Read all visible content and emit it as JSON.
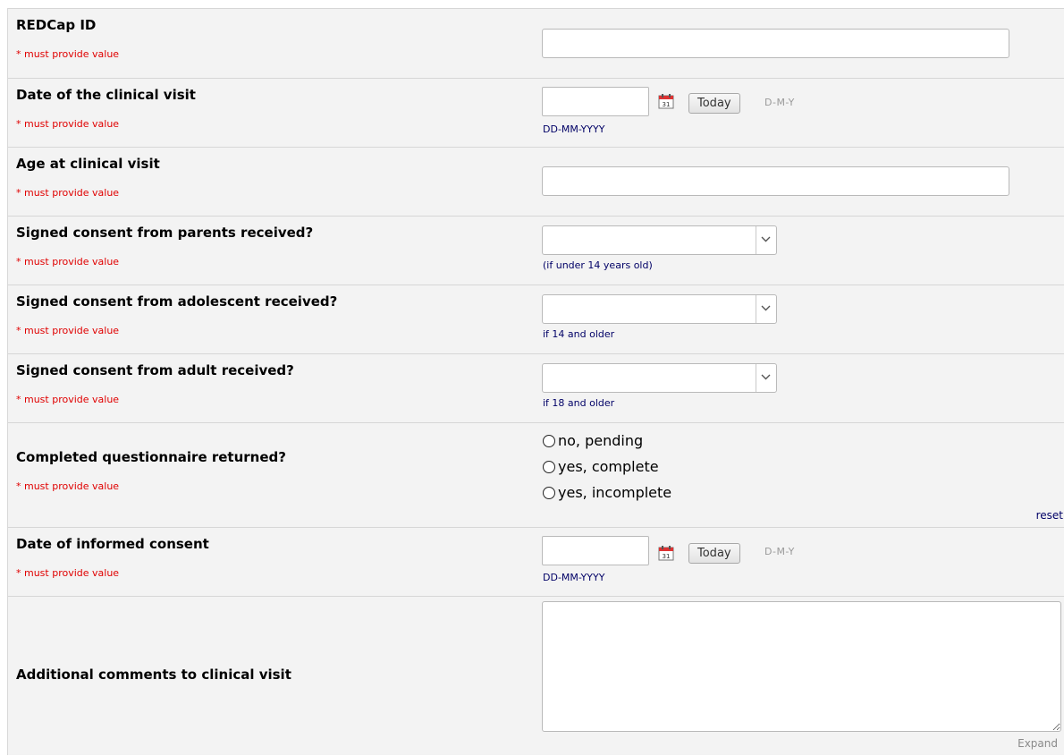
{
  "required_text": "* must provide value",
  "fields": {
    "redcap_id": {
      "label": "REDCap ID",
      "value": ""
    },
    "visit_date": {
      "label": "Date of the clinical visit",
      "value": "",
      "today_label": "Today",
      "format_hint": "D-M-Y",
      "format_note": "DD-MM-YYYY"
    },
    "age": {
      "label": "Age at clinical visit",
      "value": ""
    },
    "consent_parents": {
      "label": "Signed consent from parents received?",
      "selected": "",
      "note": "(if under 14 years old)"
    },
    "consent_adolescent": {
      "label": "Signed consent from adolescent received?",
      "selected": "",
      "note": "if 14 and older"
    },
    "consent_adult": {
      "label": "Signed consent from adult received?",
      "selected": "",
      "note": "if 18 and older"
    },
    "questionnaire": {
      "label": "Completed questionnaire returned?",
      "options": [
        "no, pending",
        "yes, complete",
        "yes, incomplete"
      ],
      "reset_label": "reset"
    },
    "consent_date": {
      "label": "Date of informed consent",
      "value": "",
      "today_label": "Today",
      "format_hint": "D-M-Y",
      "format_note": "DD-MM-YYYY"
    },
    "comments": {
      "label": "Additional comments to clinical visit",
      "value": "",
      "expand_label": "Expand"
    }
  },
  "colors": {
    "row_bg": "#f3f3f3",
    "required": "#e00000",
    "note": "#000066"
  },
  "icons": {
    "calendar": "calendar-icon",
    "dropdown": "chevron-down-icon"
  }
}
